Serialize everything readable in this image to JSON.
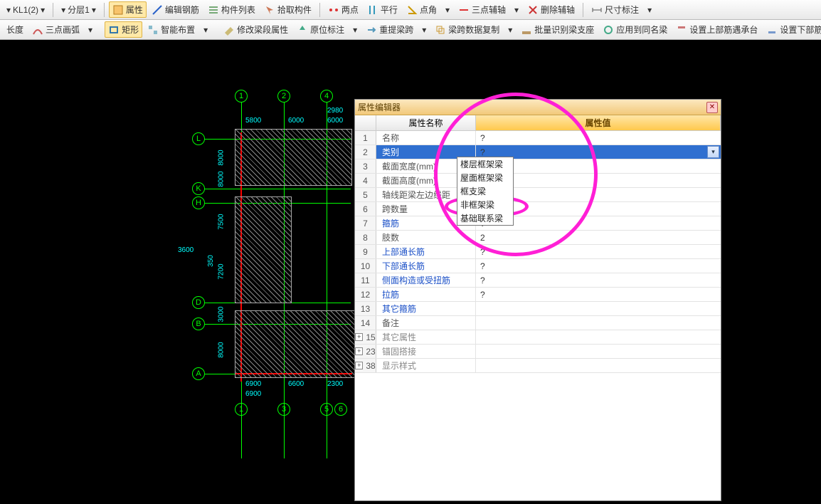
{
  "toolbar1": {
    "beam_select": "KL1(2)",
    "floor_select": "分层1",
    "attr": "属性",
    "edit_rebar": "编辑钢筋",
    "member_list": "构件列表",
    "pick_member": "拾取构件",
    "two_point": "两点",
    "parallel": "平行",
    "point_angle": "点角",
    "three_aux": "三点辅轴",
    "del_aux": "删除辅轴",
    "dimension": "尺寸标注"
  },
  "toolbar2": {
    "length": "长度",
    "arc": "三点画弧",
    "rect": "矩形",
    "smart": "智能布置",
    "mod_span": "修改梁段属性",
    "orig_label": "原位标注",
    "rearrange": "重提梁跨",
    "copy_data": "梁跨数据复制",
    "batch_support": "批量识别梁支座",
    "apply_same": "应用到同名梁",
    "upper_cap": "设置上部筋遇承台",
    "lower_cap": "设置下部筋遇承台"
  },
  "panel": {
    "title": "属性编辑器",
    "col_name": "属性名称",
    "col_value": "属性值"
  },
  "rows": [
    {
      "n": "1",
      "name": "名称",
      "cls": "plain",
      "val": "?"
    },
    {
      "n": "2",
      "name": "类别",
      "cls": "plain",
      "val": "?",
      "selected": true,
      "dropdown": true
    },
    {
      "n": "3",
      "name": "截面宽度(mm)",
      "cls": "plain",
      "val": ""
    },
    {
      "n": "4",
      "name": "截面高度(mm)",
      "cls": "plain",
      "val": ""
    },
    {
      "n": "5",
      "name": "轴线距梁左边线距",
      "cls": "plain",
      "val": ""
    },
    {
      "n": "6",
      "name": "跨数量",
      "cls": "plain",
      "val": "?"
    },
    {
      "n": "7",
      "name": "箍筋",
      "cls": "link",
      "val": "?"
    },
    {
      "n": "8",
      "name": "肢数",
      "cls": "plain",
      "val": "2"
    },
    {
      "n": "9",
      "name": "上部通长筋",
      "cls": "link",
      "val": "?"
    },
    {
      "n": "10",
      "name": "下部通长筋",
      "cls": "link",
      "val": "?"
    },
    {
      "n": "11",
      "name": "侧面构造或受扭筋",
      "cls": "link",
      "val": "?"
    },
    {
      "n": "12",
      "name": "拉筋",
      "cls": "link",
      "val": "?"
    },
    {
      "n": "13",
      "name": "其它箍筋",
      "cls": "link",
      "val": ""
    },
    {
      "n": "14",
      "name": "备注",
      "cls": "plain",
      "val": ""
    },
    {
      "n": "15",
      "name": "其它属性",
      "cls": "gray",
      "val": "",
      "expand": true
    },
    {
      "n": "23",
      "name": "锚固搭接",
      "cls": "gray",
      "val": "",
      "expand": true
    },
    {
      "n": "38",
      "name": "显示样式",
      "cls": "gray",
      "val": "",
      "expand": true
    }
  ],
  "combo": [
    "楼层框架梁",
    "屋面框架梁",
    "框支梁",
    "非框架梁",
    "基础联系梁"
  ],
  "cad": {
    "top_bubbles": [
      "1",
      "2",
      "4"
    ],
    "bottom_bubbles": [
      "1",
      "3",
      "5",
      "6"
    ],
    "left_bubbles": [
      "L",
      "K",
      "H",
      "D",
      "B",
      "A"
    ],
    "dims_top": [
      "5800",
      "6000",
      "6000",
      "2980"
    ],
    "dims_left": [
      "8000",
      "8000",
      "7500",
      "7200",
      "3000",
      "8000"
    ],
    "dims_bottom": [
      "6900",
      "6900",
      "6600",
      "2300"
    ],
    "dim_3600": "3600",
    "dim_350": "350",
    "dim_2980": "2980"
  }
}
